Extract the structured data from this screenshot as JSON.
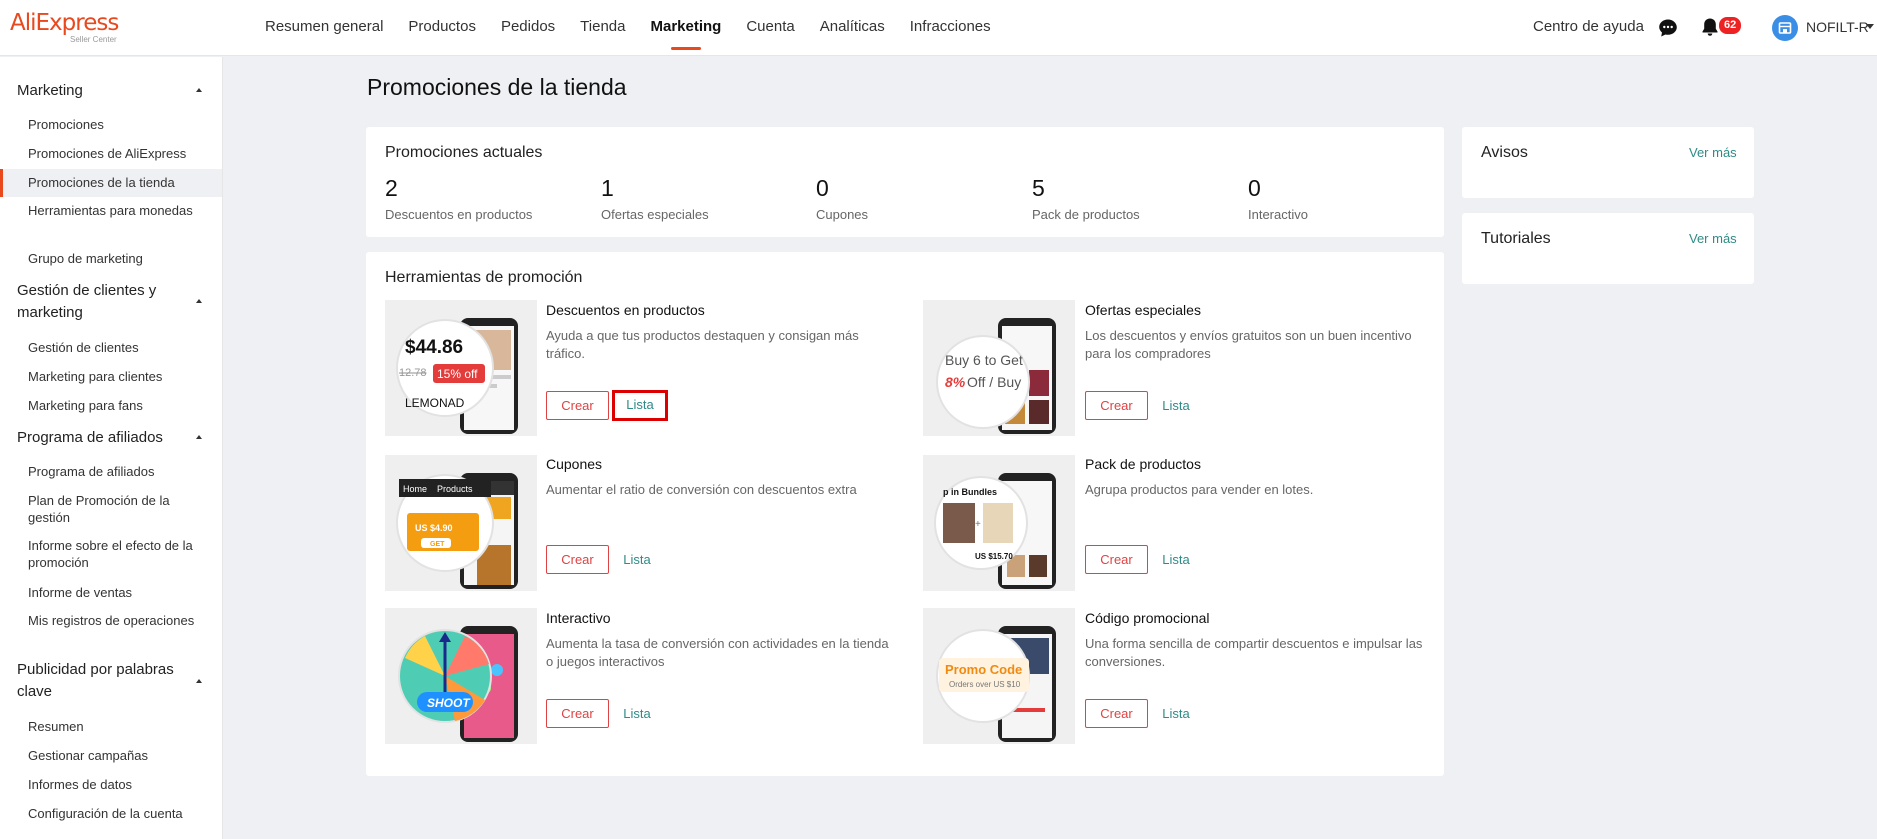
{
  "brand": {
    "logo_text": "AliExpress",
    "logo_sub": "Seller Center"
  },
  "nav": {
    "items": [
      {
        "label": "Resumen general"
      },
      {
        "label": "Productos"
      },
      {
        "label": "Pedidos"
      },
      {
        "label": "Tienda"
      },
      {
        "label": "Marketing",
        "active": true
      },
      {
        "label": "Cuenta"
      },
      {
        "label": "Analíticas"
      },
      {
        "label": "Infracciones"
      }
    ],
    "help": "Centro de ayuda",
    "notifications": "62",
    "user": "NOFILT-R"
  },
  "sidebar": {
    "sections": [
      {
        "title": "Marketing",
        "items": [
          "Promociones",
          "Promociones de AliExpress",
          "Promociones de la tienda",
          "Herramientas para monedas",
          "Grupo de marketing"
        ]
      },
      {
        "title": "Gestión de clientes y marketing",
        "items": [
          "Gestión de clientes",
          "Marketing para clientes",
          "Marketing para fans"
        ]
      },
      {
        "title": "Programa de afiliados",
        "items": [
          "Programa de afiliados",
          "Plan de Promoción de la gestión",
          "Informe sobre el efecto de la promoción",
          "Informe de ventas",
          "Mis registros de operaciones"
        ]
      },
      {
        "title": "Publicidad por palabras clave",
        "items": [
          "Resumen",
          "Gestionar campañas",
          "Informes de datos",
          "Configuración de la cuenta"
        ]
      }
    ],
    "active_item": "Promociones de la tienda"
  },
  "main": {
    "page_title": "Promociones de la tienda",
    "current": {
      "title": "Promociones actuales",
      "stats": [
        {
          "value": "2",
          "label": "Descuentos en productos"
        },
        {
          "value": "1",
          "label": "Ofertas especiales"
        },
        {
          "value": "0",
          "label": "Cupones"
        },
        {
          "value": "5",
          "label": "Pack de productos"
        },
        {
          "value": "0",
          "label": "Interactivo"
        }
      ]
    },
    "tools": {
      "title": "Herramientas de promoción",
      "create_label": "Crear",
      "list_label": "Lista",
      "items": [
        {
          "title": "Descuentos en productos",
          "desc": "Ayuda a que tus productos destaquen y consigan más tráfico.",
          "img_text": [
            "$44.86",
            "12.78",
            "15% off",
            "LEMONAD"
          ]
        },
        {
          "title": "Ofertas especiales",
          "desc": "Los descuentos y envíos gratuitos son un buen incentivo para los compradores",
          "img_text": [
            "Buy 6 to Get",
            "8%",
            "Off / Buy"
          ]
        },
        {
          "title": "Cupones",
          "desc": "Aumentar el ratio de conversión con descuentos extra",
          "img_text": [
            "Home",
            "Products",
            "US $4.90",
            "GET"
          ]
        },
        {
          "title": "Pack de productos",
          "desc": "Agrupa productos para vender en lotes.",
          "img_text": [
            "p in Bundles",
            "US $15.70"
          ]
        },
        {
          "title": "Interactivo",
          "desc": "Aumenta la tasa de conversión con actividades en la tienda o juegos interactivos",
          "img_text": [
            "SHOOT"
          ]
        },
        {
          "title": "Código promocional",
          "desc": "Una forma sencilla de compartir descuentos e impulsar las conversiones.",
          "img_text": [
            "Promo Code",
            "Orders over US $10"
          ]
        }
      ]
    },
    "notices": {
      "title": "Avisos",
      "more": "Ver más"
    },
    "tutorials": {
      "title": "Tutoriales",
      "more": "Ver más"
    }
  },
  "colors": {
    "brand": "#e8491d",
    "link": "#2e8b87",
    "create": "#dd4444",
    "background": "#eef0f3"
  }
}
